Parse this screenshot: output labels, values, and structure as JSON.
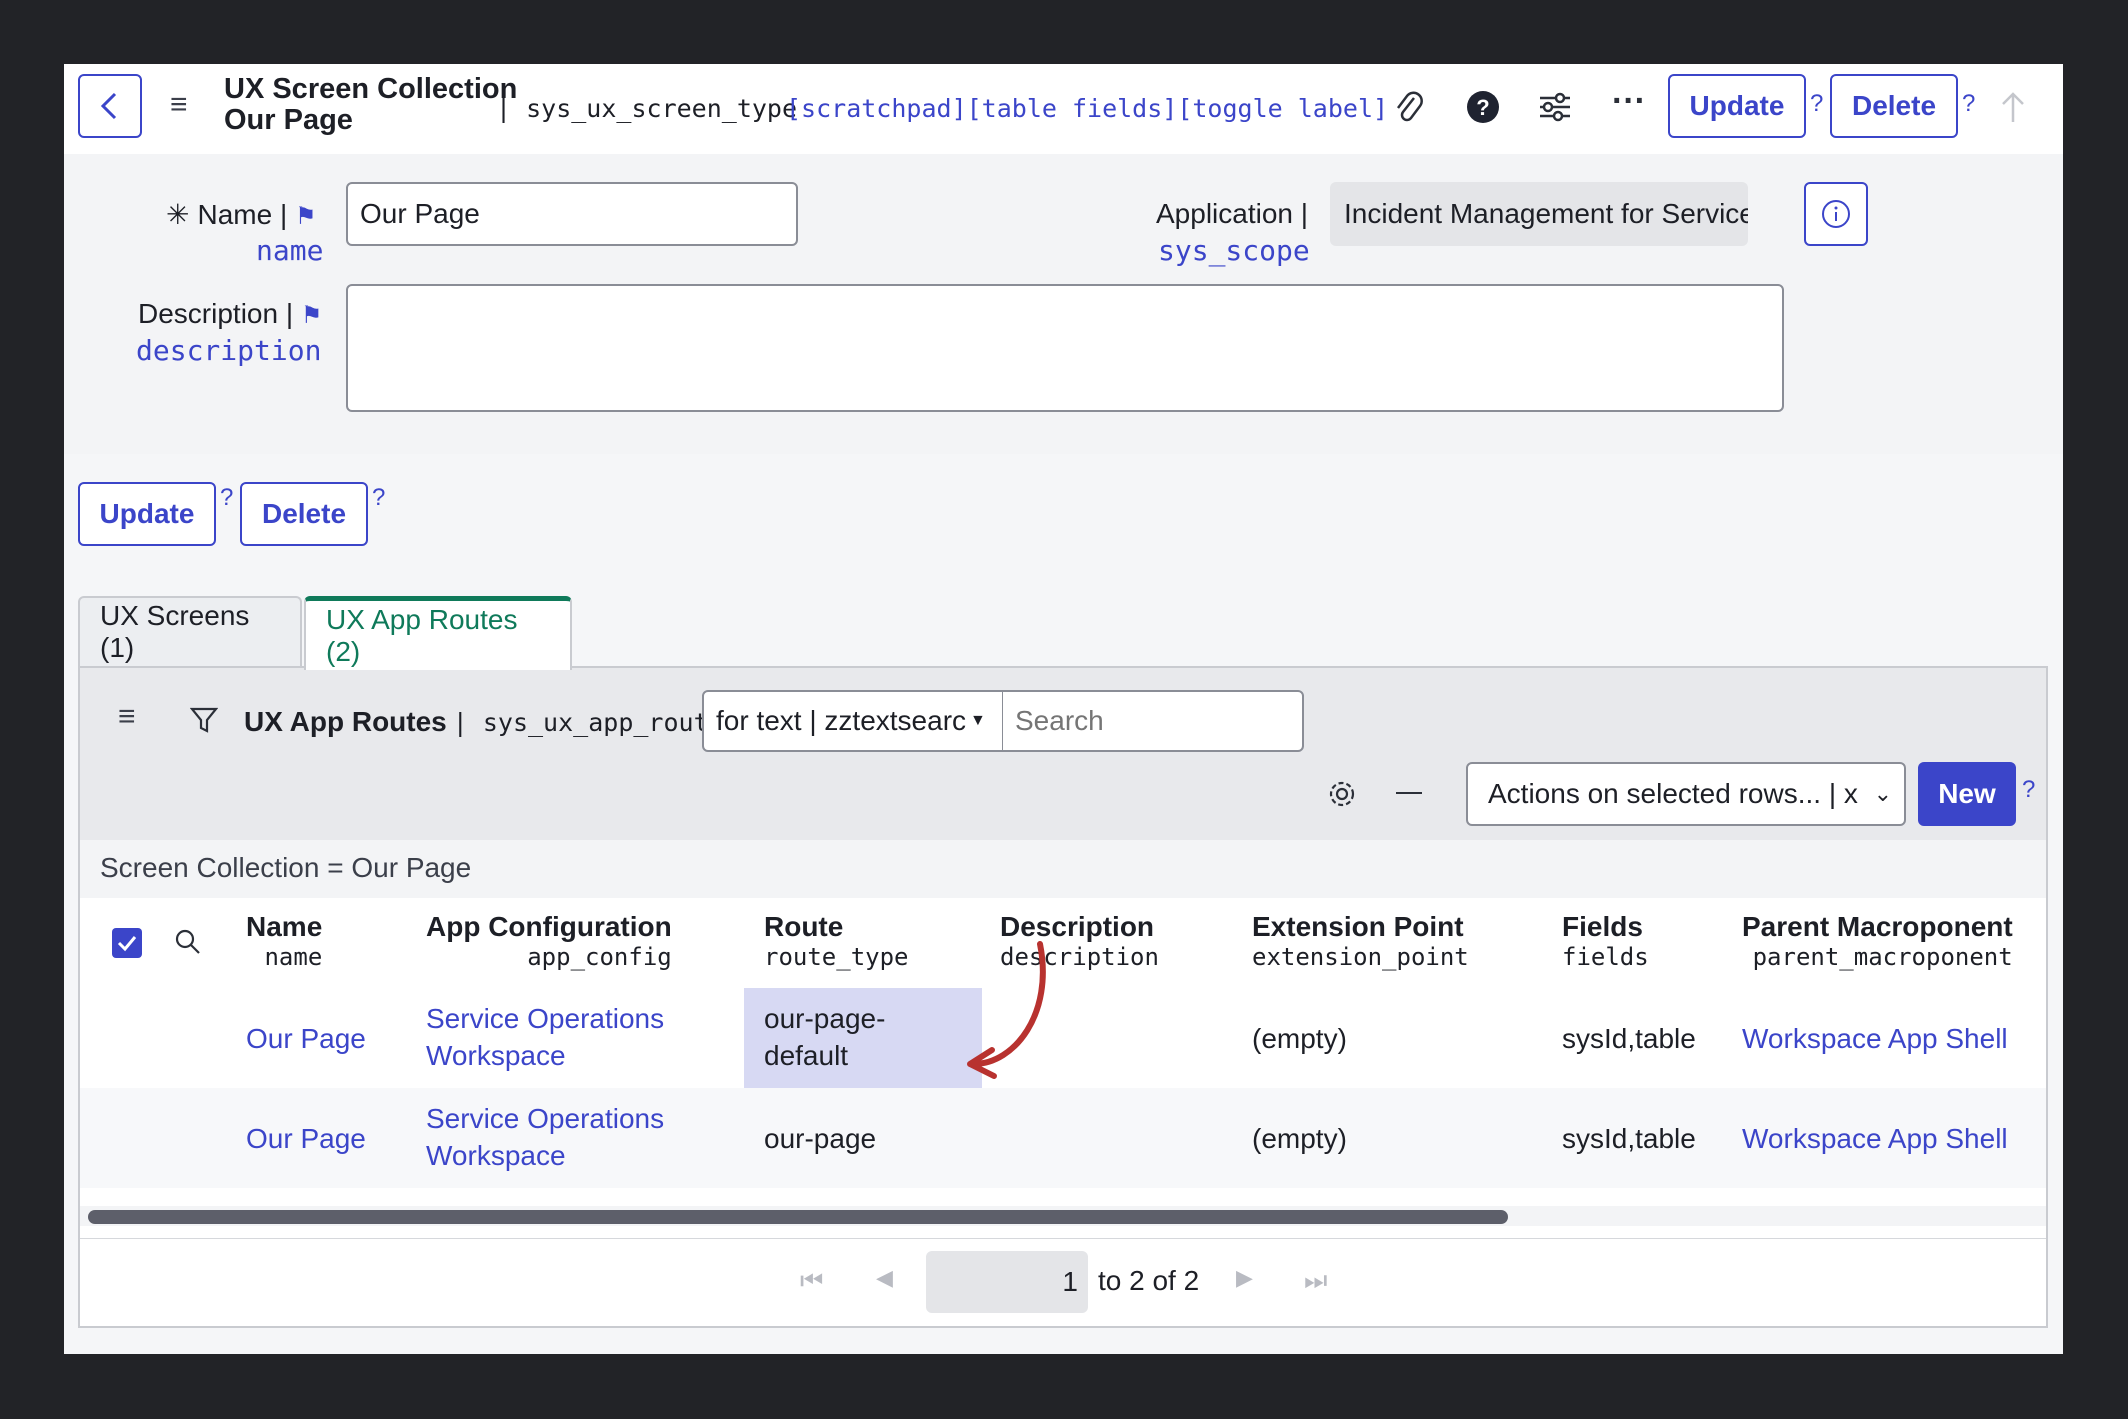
{
  "header": {
    "title_line1": "UX Screen Collection",
    "title_line2": "Our Page",
    "table_name": "| sys_ux_screen_type",
    "links": "[scratchpad][table fields][toggle label]",
    "update_label": "Update",
    "delete_label": "Delete",
    "help": "?"
  },
  "form": {
    "name_label": "Name |",
    "name_field": "name",
    "name_value": "Our Page",
    "application_label": "Application |",
    "application_field": "sys_scope",
    "application_value": "Incident Management for Service C",
    "description_label": "Description |",
    "description_field": "description",
    "description_value": "",
    "required_mark": "✳"
  },
  "form_actions": {
    "update_label": "Update",
    "delete_label": "Delete",
    "help": "?"
  },
  "tabs": [
    {
      "label": "UX Screens (1)",
      "active": false
    },
    {
      "label": "UX App Routes (2)",
      "active": true
    }
  ],
  "list": {
    "title": "UX App Routes",
    "table": "| sys_ux_app_route",
    "search_field_select": "for text | zztextsearc",
    "search_placeholder": "Search",
    "actions_select": "Actions on selected rows... | x",
    "new_label": "New",
    "help": "?",
    "breadcrumb": "Screen Collection = Our Page",
    "columns": [
      {
        "label": "Name",
        "field": "name"
      },
      {
        "label": "App Configuration",
        "field": "app_config"
      },
      {
        "label": "Route",
        "field": "route_type"
      },
      {
        "label": "Description",
        "field": "description"
      },
      {
        "label": "Extension Point",
        "field": "extension_point"
      },
      {
        "label": "Fields",
        "field": "fields"
      },
      {
        "label": "Parent Macroponent",
        "field": "parent_macroponent"
      }
    ],
    "rows": [
      {
        "name": "Our Page",
        "app_config": "Service Operations Workspace",
        "route": "our-page-default",
        "description": "",
        "extension_point": "(empty)",
        "fields": "sysId,table",
        "parent": "Workspace App Shell",
        "highlighted": true
      },
      {
        "name": "Our Page",
        "app_config": "Service Operations Workspace",
        "route": "our-page",
        "description": "",
        "extension_point": "(empty)",
        "fields": "sysId,table",
        "parent": "Workspace App Shell",
        "highlighted": false
      }
    ],
    "pagination": {
      "current": "1",
      "range": "to 2 of 2"
    }
  },
  "colors": {
    "accent": "#3b45c9",
    "active_tab": "#0f7a5a",
    "highlight": "#d7d9f3",
    "annotation_arrow": "#b8322f"
  },
  "icons": [
    "back-icon",
    "menu-icon",
    "paperclip-icon",
    "help-circle-icon",
    "sliders-icon",
    "more-icon",
    "arrow-up-icon",
    "flag-icon",
    "info-icon",
    "filter-icon",
    "gear-icon",
    "collapse-icon",
    "checkbox-icon",
    "search-icon",
    "first-page-icon",
    "prev-page-icon",
    "next-page-icon",
    "last-page-icon",
    "chevron-down-icon"
  ]
}
